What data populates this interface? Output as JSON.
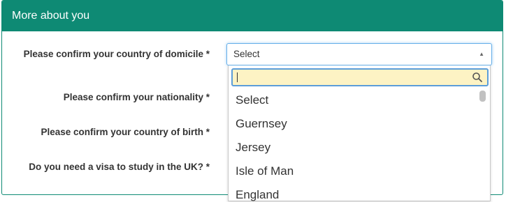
{
  "panel": {
    "title": "More about you"
  },
  "questions": {
    "domicile": "Please confirm your country of domicile *",
    "nationality": "Please confirm your nationality *",
    "birth": "Please confirm your country of birth *",
    "visa": "Do you need a visa to study in the UK? *"
  },
  "domicile_select": {
    "value": "Select"
  },
  "dropdown": {
    "search_value": "",
    "options": [
      "Select",
      "Guernsey",
      "Jersey",
      "Isle of Man",
      "England"
    ]
  },
  "icons": {
    "search": "search-icon",
    "arrow": "chevron-up-icon"
  },
  "colors": {
    "header_bg": "#0e8a74",
    "search_bg": "#fdf3c4",
    "focus_border": "#5b9dd9"
  }
}
